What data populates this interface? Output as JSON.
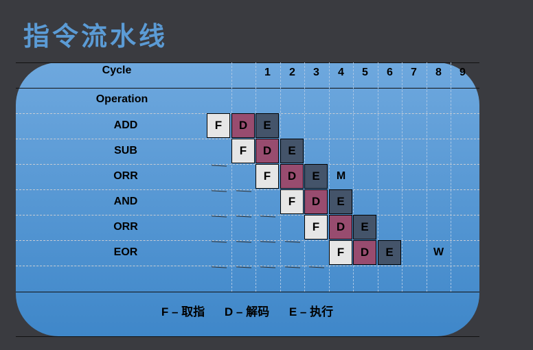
{
  "title": "指令流水线",
  "header": {
    "cycle": "Cycle",
    "operation": "Operation",
    "cycles": [
      "1",
      "2",
      "3",
      "4",
      "5",
      "6",
      "7",
      "8",
      "9"
    ]
  },
  "stages": {
    "F": "F",
    "D": "D",
    "E": "E"
  },
  "colors": {
    "F": "#e6e6e6",
    "D": "#984c6f",
    "E": "#44546a"
  },
  "operations": [
    {
      "name": "ADD",
      "start": 0
    },
    {
      "name": "SUB",
      "start": 1
    },
    {
      "name": "ORR",
      "start": 2,
      "note": "M"
    },
    {
      "name": "AND",
      "start": 3
    },
    {
      "name": "ORR",
      "start": 4
    },
    {
      "name": "EOR",
      "start": 5,
      "note": "W"
    }
  ],
  "legend": [
    "F – 取指",
    "D – 解码",
    "E – 执行"
  ]
}
